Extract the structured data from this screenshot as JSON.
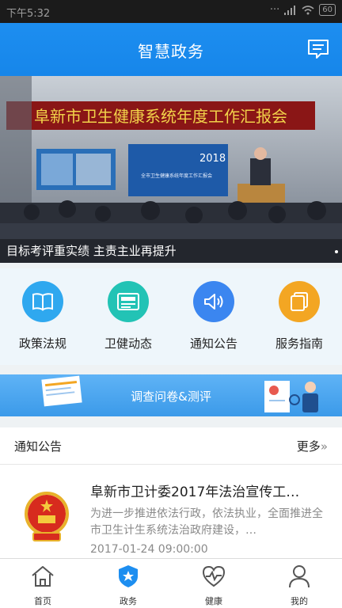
{
  "status_bar": {
    "time": "下午5:32",
    "battery": "60"
  },
  "app_bar": {
    "title": "智慧政务"
  },
  "banner": {
    "headline": "阜新市卫生健康系统年度工作汇报会",
    "screen_year": "2018",
    "screen_text": "全市卫生健康系统年度工作汇报会",
    "caption": "目标考评重实绩 主责主业再提升"
  },
  "features": [
    {
      "label": "政策法规",
      "color": "#2fa8ef",
      "icon": "book-icon"
    },
    {
      "label": "卫健动态",
      "color": "#22c3b5",
      "icon": "news-icon"
    },
    {
      "label": "通知公告",
      "color": "#3b86f0",
      "icon": "speaker-icon"
    },
    {
      "label": "服务指南",
      "color": "#f3a623",
      "icon": "layers-icon"
    }
  ],
  "survey": {
    "label": "调查问卷&测评"
  },
  "notices": {
    "header_title": "通知公告",
    "more_label": "更多",
    "more_glyph": "»",
    "items": [
      {
        "title": "阜新市卫计委2017年法治宣传工…",
        "summary": "为进一步推进依法行政，依法执业，全面推进全市卫生计生系统法治政府建设，…",
        "date": "2017-01-24 09:00:00"
      }
    ]
  },
  "tabs": [
    {
      "label": "首页",
      "icon": "home-icon"
    },
    {
      "label": "政务",
      "icon": "shield-star-icon",
      "active": true
    },
    {
      "label": "健康",
      "icon": "heart-pulse-icon"
    },
    {
      "label": "我的",
      "icon": "user-icon"
    }
  ]
}
